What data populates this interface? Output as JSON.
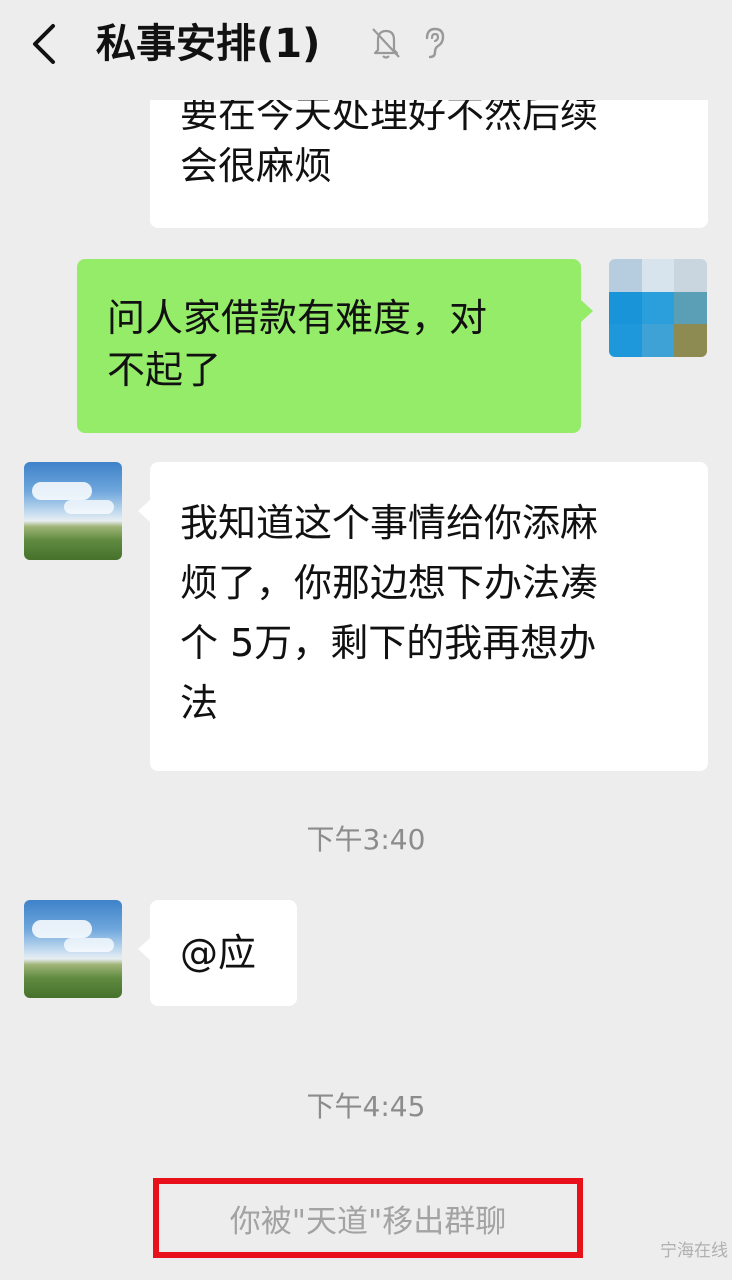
{
  "header": {
    "title": "私事安排(1)",
    "back_icon": "chevron-left-icon",
    "mute_icon": "bell-off-icon",
    "earpiece_icon": "ear-icon"
  },
  "messages": [
    {
      "sender": "other",
      "lines": [
        "要在今天处理好不然后续",
        "会很麻烦"
      ]
    },
    {
      "sender": "me",
      "lines": [
        "问人家借款有难度，对",
        "不起了"
      ]
    },
    {
      "sender": "other",
      "lines": [
        "我知道这个事情给你添麻",
        "烦了，你那边想下办法凑",
        "个 5万，剩下的我再想办",
        "法"
      ]
    },
    {
      "sender": "other",
      "lines": [
        "@应"
      ]
    }
  ],
  "timestamps": [
    "下午3:40",
    "下午4:45"
  ],
  "system_message": "你被\"天道\"移出群聊",
  "watermark": "宁海在线",
  "colors": {
    "background": "#ededed",
    "my_bubble": "#95ec69",
    "other_bubble": "#ffffff",
    "highlight_border": "#e8101b"
  }
}
